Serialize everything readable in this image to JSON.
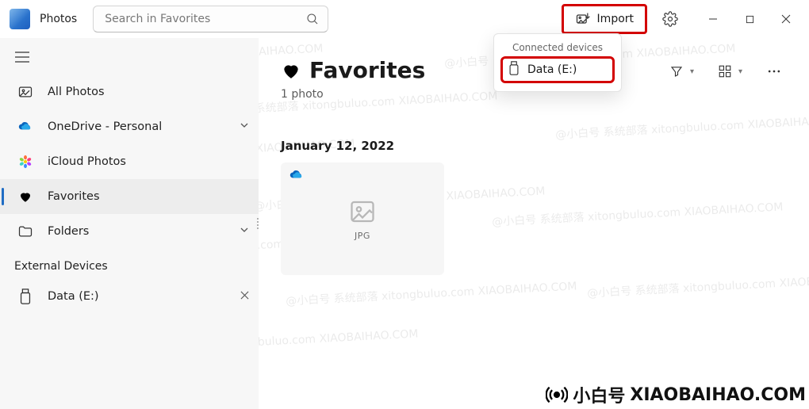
{
  "app": {
    "title": "Photos"
  },
  "search": {
    "placeholder": "Search in Favorites"
  },
  "toolbar": {
    "import_label": "Import"
  },
  "sidebar": {
    "all_photos": "All Photos",
    "onedrive": "OneDrive - Personal",
    "icloud": "iCloud Photos",
    "favorites": "Favorites",
    "folders": "Folders",
    "external_section": "External Devices",
    "external_drive": "Data (E:)"
  },
  "page": {
    "title": "Favorites",
    "subtitle": "1 photo",
    "date_header": "January 12, 2022"
  },
  "devices_panel": {
    "title": "Connected devices",
    "drive": "Data (E:)"
  },
  "thumb": {
    "ext": "JPG"
  },
  "watermark": {
    "brand_cn": "小白号",
    "brand_en": "XIAOBAIHAO.COM"
  }
}
